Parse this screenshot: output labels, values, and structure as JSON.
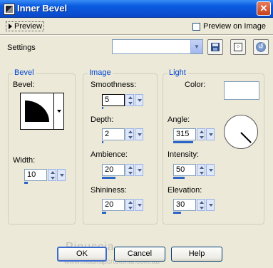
{
  "window": {
    "title": "Inner Bevel",
    "close_glyph": "✕"
  },
  "top": {
    "preview_label": "Preview",
    "preview_on_image_label": "Preview on Image",
    "preview_on_image_checked": false,
    "settings_label": "Settings",
    "settings_value": ""
  },
  "toolbar": {
    "save_icon": "save-floppy",
    "randomize_icon": "dice",
    "reset_icon": "reset"
  },
  "bevel": {
    "group_label": "Bevel",
    "bevel_label": "Bevel:",
    "width_label": "Width:",
    "width_value": "10",
    "width_fraction": 0.15
  },
  "image": {
    "group_label": "Image",
    "smoothness_label": "Smoothness:",
    "smoothness_value": "5",
    "smoothness_fraction": 0.05,
    "depth_label": "Depth:",
    "depth_value": "2",
    "depth_fraction": 0.06,
    "ambience_label": "Ambience:",
    "ambience_value": "20",
    "ambience_fraction": 0.6,
    "shininess_label": "Shininess:",
    "shininess_value": "20",
    "shininess_fraction": 0.2
  },
  "light": {
    "group_label": "Light",
    "color_label": "Color:",
    "color_value": "#ffffff",
    "angle_label": "Angle:",
    "angle_value": "315",
    "angle_fraction": 0.875,
    "intensity_label": "Intensity:",
    "intensity_value": "50",
    "intensity_fraction": 0.5,
    "elevation_label": "Elevation:",
    "elevation_value": "30",
    "elevation_fraction": 0.35
  },
  "buttons": {
    "ok": "OK",
    "cancel": "Cancel",
    "help": "Help"
  },
  "watermark": {
    "text": "Pinuccia",
    "url": "www.madirapcrtutorial.com.au"
  },
  "colors": {
    "titlebar": "#0a5be0",
    "group_title": "#0046d5",
    "dialog_bg": "#ece9d8",
    "slider_bar": "#2c65c8"
  }
}
